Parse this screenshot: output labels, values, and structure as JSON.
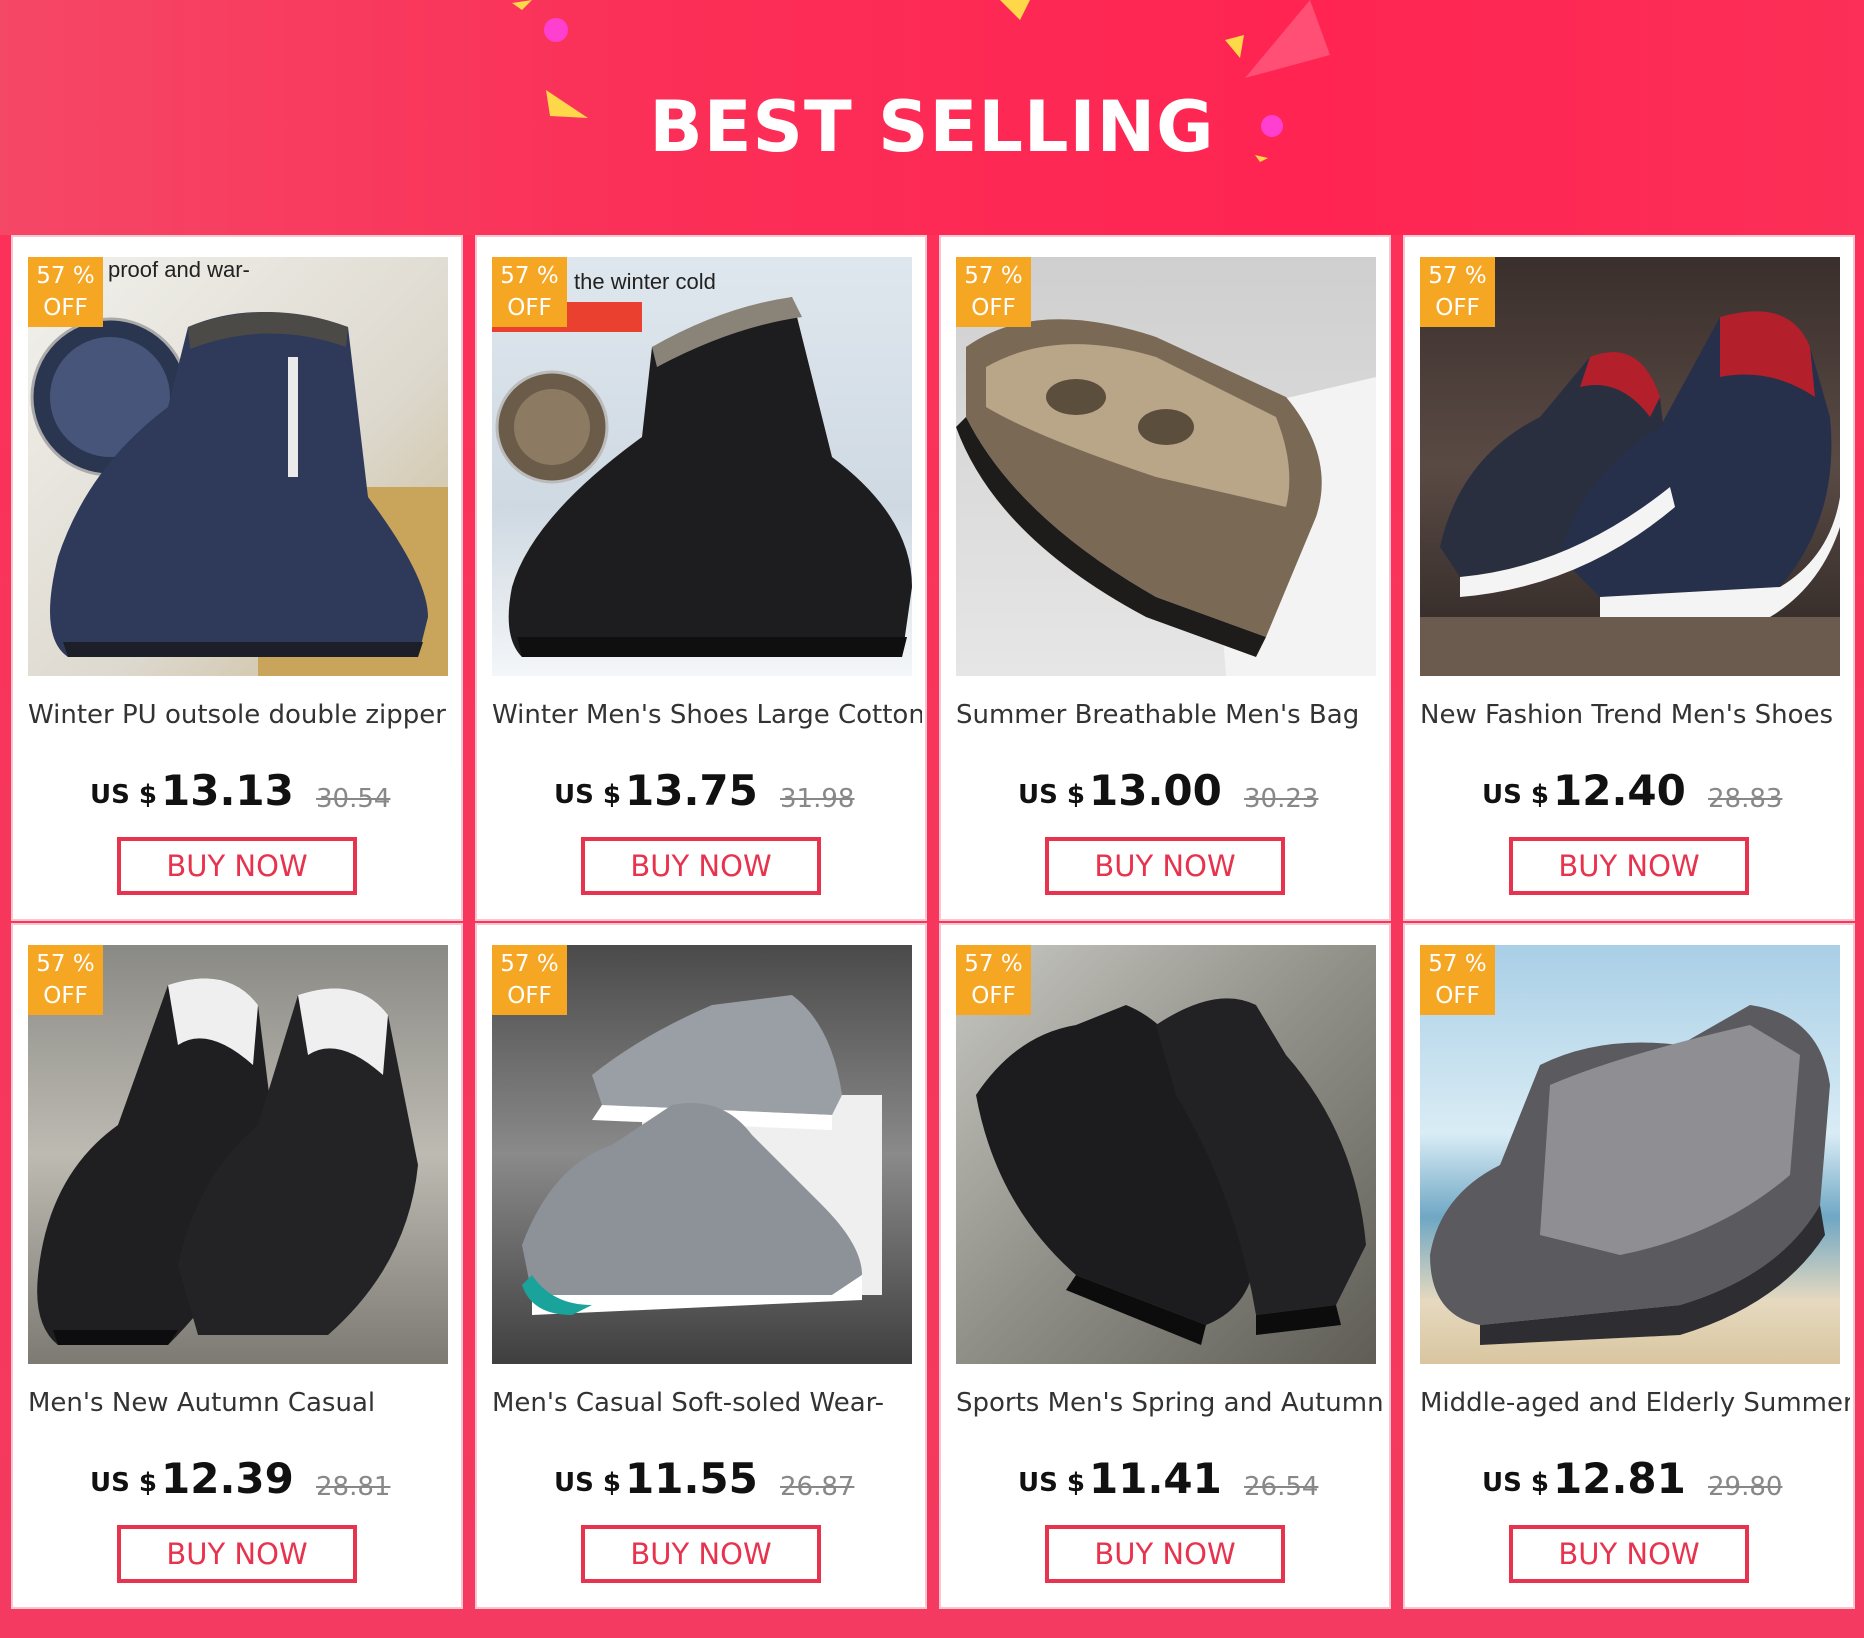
{
  "banner": {
    "title": "BEST SELLING"
  },
  "products": [
    {
      "overlay": "proof and war-",
      "discount_pct": "57 %",
      "discount_off": "OFF",
      "title": "Winter PU outsole double zipper",
      "currency": "US $",
      "price": "13.13",
      "old_price": "30.54",
      "buy_label": "BUY NOW"
    },
    {
      "overlay": "the winter cold",
      "discount_pct": "57 %",
      "discount_off": "OFF",
      "title": "Winter Men's Shoes Large Cotton",
      "currency": "US $",
      "price": "13.75",
      "old_price": "31.98",
      "buy_label": "BUY NOW"
    },
    {
      "overlay": "",
      "discount_pct": "57 %",
      "discount_off": "OFF",
      "title": "Summer Breathable Men's Bag",
      "currency": "US $",
      "price": "13.00",
      "old_price": "30.23",
      "buy_label": "BUY NOW"
    },
    {
      "overlay": "",
      "discount_pct": "57 %",
      "discount_off": "OFF",
      "title": "New Fashion Trend Men's Shoes",
      "currency": "US $",
      "price": "12.40",
      "old_price": "28.83",
      "buy_label": "BUY NOW"
    },
    {
      "overlay": "",
      "discount_pct": "57 %",
      "discount_off": "OFF",
      "title": "Men's New Autumn Casual",
      "currency": "US $",
      "price": "12.39",
      "old_price": "28.81",
      "buy_label": "BUY NOW"
    },
    {
      "overlay": "",
      "discount_pct": "57 %",
      "discount_off": "OFF",
      "title": "Men's Casual Soft-soled Wear-",
      "currency": "US $",
      "price": "11.55",
      "old_price": "26.87",
      "buy_label": "BUY NOW"
    },
    {
      "overlay": "",
      "discount_pct": "57 %",
      "discount_off": "OFF",
      "title": "Sports Men's Spring and Autumn",
      "currency": "US $",
      "price": "11.41",
      "old_price": "26.54",
      "buy_label": "BUY NOW"
    },
    {
      "overlay": "",
      "discount_pct": "57 %",
      "discount_off": "OFF",
      "title": "Middle-aged and Elderly Summer",
      "currency": "US $",
      "price": "12.81",
      "old_price": "29.80",
      "buy_label": "BUY NOW"
    }
  ],
  "colors": {
    "accent": "#e8334f",
    "badge": "#f5a623",
    "banner": "#ff2452"
  }
}
